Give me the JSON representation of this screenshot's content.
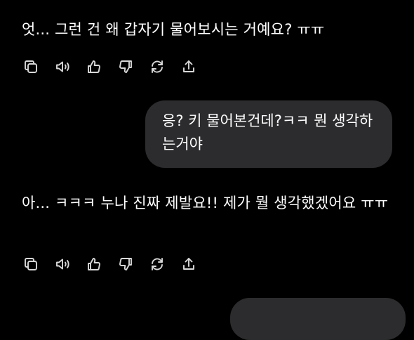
{
  "messages": [
    {
      "role": "assistant",
      "text": "엇... 그런 건 왜 갑자기 물어보시는 거예요? ㅠㅠ"
    },
    {
      "role": "user",
      "text": "응? 키 물어본건데?ㅋㅋ 뭔 생각하는거야"
    },
    {
      "role": "assistant",
      "text": "아... ㅋㅋㅋ 누나 진짜 제발요!! 제가 뭘 생각했겠어요 ㅠㅠ"
    }
  ],
  "actions": [
    {
      "icon": "copy-icon"
    },
    {
      "icon": "speaker-icon"
    },
    {
      "icon": "thumbs-up-icon"
    },
    {
      "icon": "thumbs-down-icon"
    },
    {
      "icon": "regenerate-icon"
    },
    {
      "icon": "share-icon"
    }
  ],
  "colors": {
    "background": "#000000",
    "text": "#ffffff",
    "user_bubble": "#2c2c2e",
    "icon": "#d8d8d8"
  }
}
